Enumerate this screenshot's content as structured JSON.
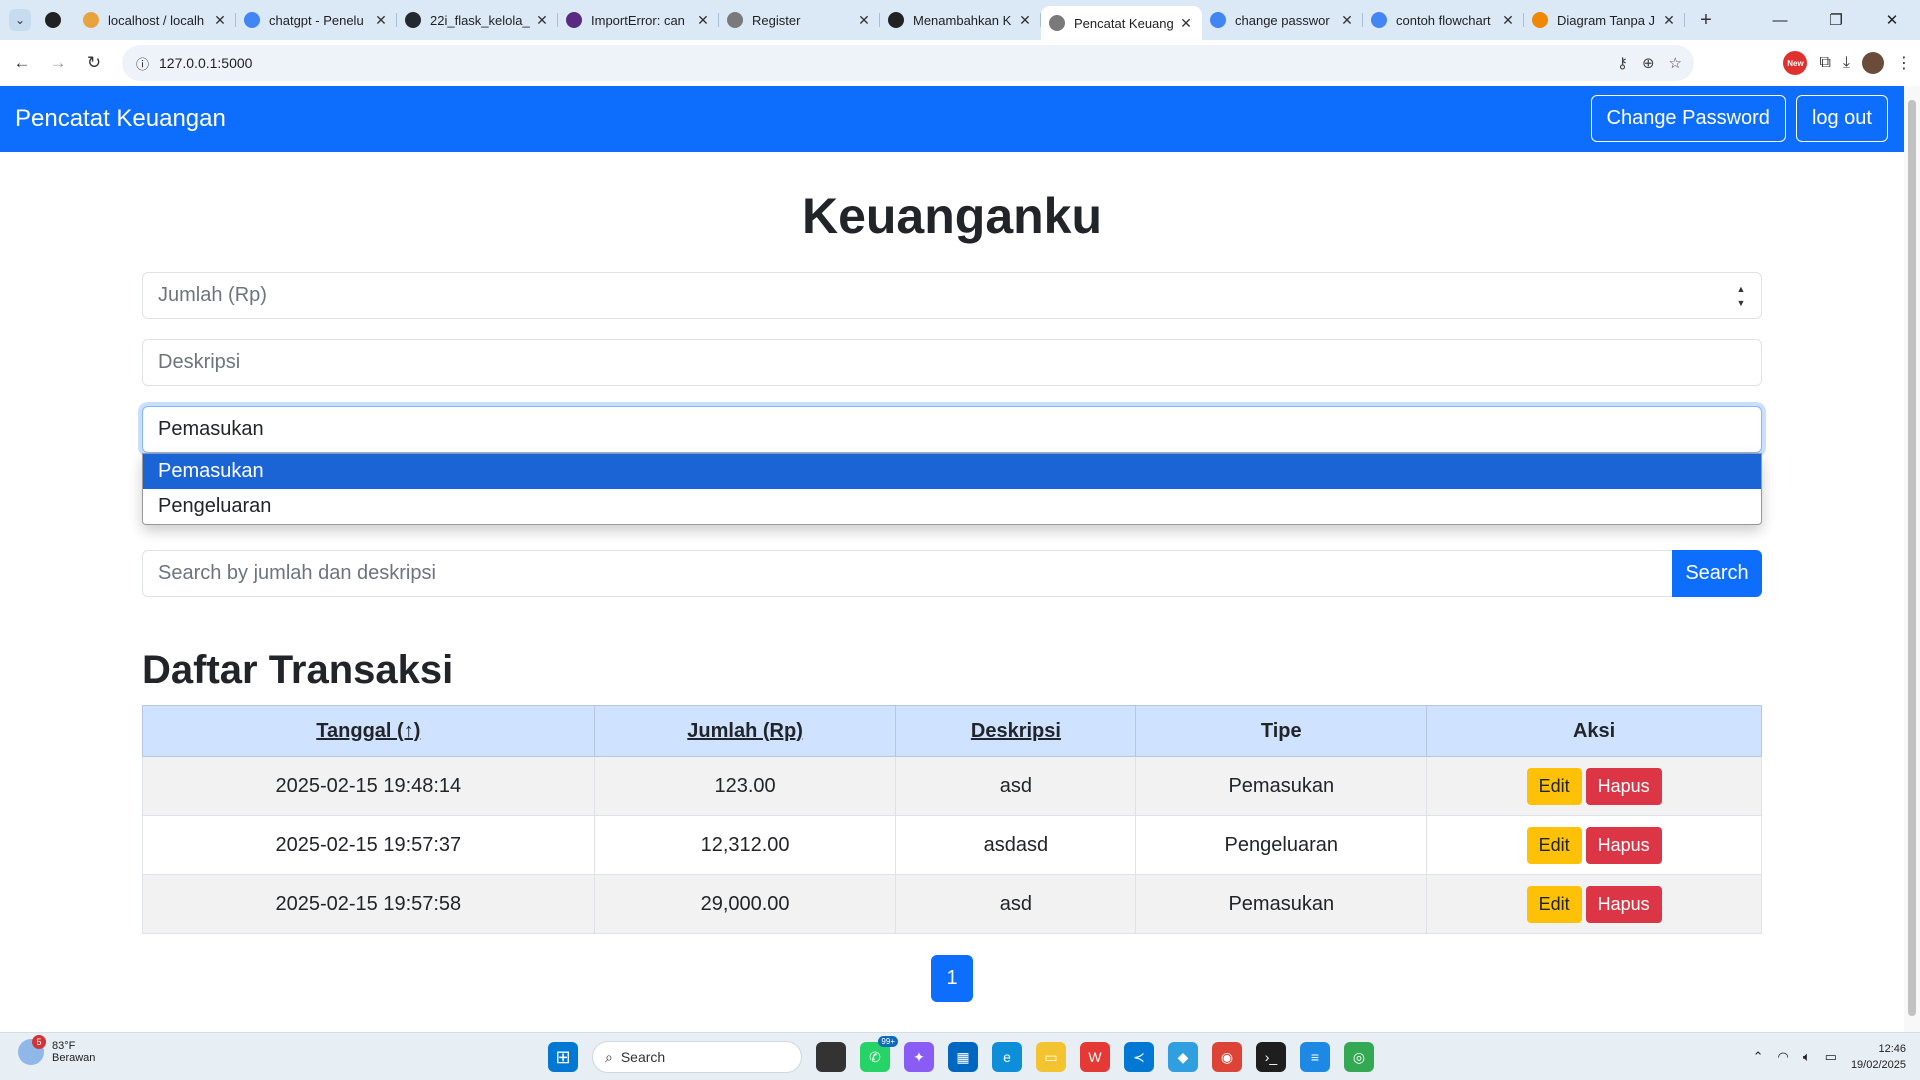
{
  "browser": {
    "tabs": [
      {
        "title": "localhost / localh",
        "color": "#e8a33d"
      },
      {
        "title": "chatgpt - Penelu",
        "color": "#4285f4"
      },
      {
        "title": "22i_flask_kelola_",
        "color": "#24292f"
      },
      {
        "title": "ImportError: can",
        "color": "#5a2a82"
      },
      {
        "title": "Register",
        "color": "#7a7a7a"
      },
      {
        "title": "Menambahkan K",
        "color": "#222222"
      },
      {
        "title": "Pencatat Keuang",
        "color": "#7a7a7a",
        "active": true
      },
      {
        "title": "change passwor",
        "color": "#4285f4"
      },
      {
        "title": "contoh flowchart",
        "color": "#4285f4"
      },
      {
        "title": "Diagram Tanpa J",
        "color": "#f08705"
      }
    ],
    "url": "127.0.0.1:5000",
    "ext_badge": "New"
  },
  "navbar": {
    "brand": "Pencatat Keuangan",
    "change_password": "Change Password",
    "logout": "log out"
  },
  "page": {
    "title": "Keuanganku",
    "amount_placeholder": "Jumlah (Rp)",
    "description_placeholder": "Deskripsi",
    "type_selected": "Pemasukan",
    "type_options": [
      "Pemasukan",
      "Pengeluaran"
    ],
    "search_placeholder": "Search by jumlah dan deskripsi",
    "search_button": "Search",
    "list_title": "Daftar Transaksi",
    "table": {
      "headers": [
        "Tanggal (↑)",
        "Jumlah (Rp)",
        "Deskripsi",
        "Tipe",
        "Aksi"
      ],
      "rows": [
        {
          "date": "2025-02-15 19:48:14",
          "amount": "123.00",
          "description": "asd",
          "type": "Pemasukan"
        },
        {
          "date": "2025-02-15 19:57:37",
          "amount": "12,312.00",
          "description": "asdasd",
          "type": "Pengeluaran"
        },
        {
          "date": "2025-02-15 19:57:58",
          "amount": "29,000.00",
          "description": "asd",
          "type": "Pemasukan"
        }
      ],
      "edit_label": "Edit",
      "delete_label": "Hapus"
    },
    "page_number": "1"
  },
  "taskbar": {
    "weather_temp": "83°F",
    "weather_desc": "Berawan",
    "weather_badge": "5",
    "search_label": "Search",
    "whatsapp_badge": "99+",
    "time": "12:46",
    "date": "19/02/2025"
  }
}
